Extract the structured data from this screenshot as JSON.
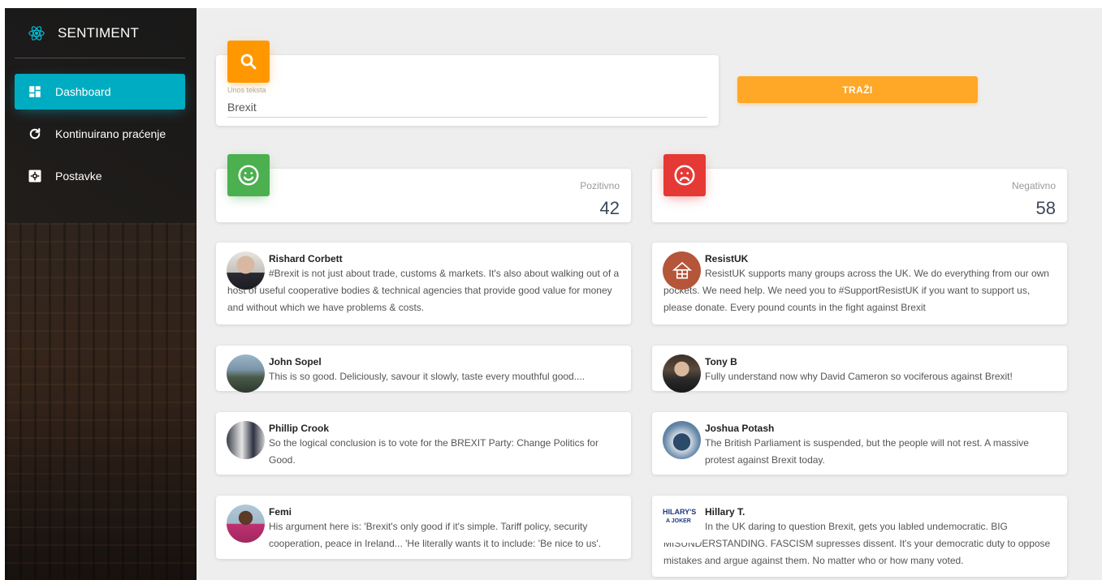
{
  "sidebar": {
    "brand": "SENTIMENT",
    "brand_icon": "react-atom-icon",
    "items": [
      {
        "label": "Dashboard",
        "icon": "dashboard-icon",
        "active": true
      },
      {
        "label": "Kontinuirano praćenje",
        "icon": "refresh-icon",
        "active": false
      },
      {
        "label": "Postavke",
        "icon": "settings-icon",
        "active": false
      }
    ]
  },
  "search": {
    "label": "Unos teksta",
    "value": "Brexit",
    "button": "TRAŽI",
    "icon": "search-icon"
  },
  "stats": {
    "positive": {
      "label": "Pozitivno",
      "value": "42",
      "icon": "smile-icon"
    },
    "negative": {
      "label": "Negativno",
      "value": "58",
      "icon": "frown-icon"
    }
  },
  "positive_tweets": [
    {
      "name": "Rishard Corbett",
      "text": "#Brexit is not just about trade, customs & markets. It's also about walking out of a host of useful cooperative bodies & technical agencies that provide good value for money and without which we have problems & costs."
    },
    {
      "name": "John Sopel",
      "text": "This is so good. Deliciously, savour it slowly, taste every mouthful good...."
    },
    {
      "name": "Phillip Crook",
      "text": "So the logical conclusion is to vote for the BREXIT Party: Change Politics for Good."
    },
    {
      "name": "Femi",
      "text": "His argument here is: 'Brexit's only good if it's simple. Tariff policy, security cooperation, peace in Ireland... 'He literally wants it to include: 'Be nice to us'."
    }
  ],
  "negative_tweets": [
    {
      "name": "ResistUK",
      "text": "ResistUK supports many groups across the UK. We do everything from our own pockets. We need help. We need you to #SupportResistUK if you want to support us, please donate. Every pound counts in the fight against Brexit"
    },
    {
      "name": "Tony B",
      "text": "Fully understand now why David Cameron so vociferous against Brexit!"
    },
    {
      "name": "Joshua Potash",
      "text": "The British Parliament is suspended, but the people will not rest. A massive protest against Brexit today."
    },
    {
      "name": "Hillary T.",
      "text": "In the UK daring to question Brexit, gets you labled undemocratic. BIG MISUNDERSTANDING. FASCISM supresses dissent. It's your democratic duty to oppose mistakes and argue against them. No matter who or how many voted.",
      "avatar_text": "HILARY'S A JOKER"
    }
  ],
  "colors": {
    "accent": "#00acc1",
    "search": "#ff9800",
    "positive": "#4caf50",
    "negative": "#e53935"
  }
}
